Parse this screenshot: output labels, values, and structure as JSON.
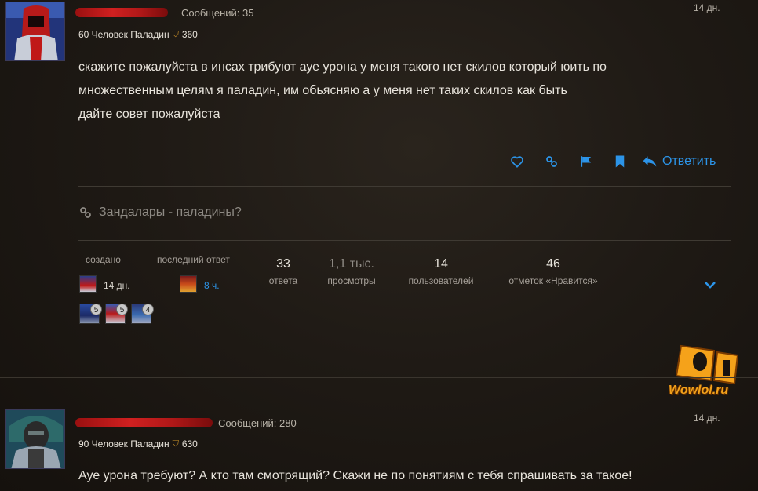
{
  "post1": {
    "posts_count": "Сообщений: 35",
    "level_class": "60 Человек Паладин",
    "achievement_points": "360",
    "date": "14 дн.",
    "body_lines": [
      "скажите пожалуйста в инсах трибуют ауе урона у меня такого нет скилов который юить по",
      "множественным целям я паладин, им обьясняю а у меня нет таких скилов как быть",
      "дайте совет пожалуйста"
    ],
    "reply_label": "Ответить"
  },
  "topic": {
    "link_text": "Зандалары - паладины?",
    "created_label": "создано",
    "created_time": "14 дн.",
    "last_reply_label": "последний ответ",
    "last_reply_time": "8 ч.",
    "stats": [
      {
        "num": "33",
        "label": "ответа"
      },
      {
        "num": "1,1 тыс.",
        "label": "просмотры"
      },
      {
        "num": "14",
        "label": "пользователей"
      },
      {
        "num": "46",
        "label": "отметок «Нравится»"
      }
    ],
    "participants": [
      {
        "count": "5"
      },
      {
        "count": "5"
      },
      {
        "count": "4"
      }
    ]
  },
  "watermark": {
    "site": "Wowlol.ru"
  },
  "post2": {
    "posts_count": "Сообщений: 280",
    "level_class": "90 Человек Паладин",
    "achievement_points": "630",
    "date": "14 дн.",
    "body": "Ауе урона требуют? А кто там смотрящий? Скажи не по понятиям с тебя спрашивать за такое!"
  },
  "colors": {
    "accent": "#2c94e8",
    "redaction": "#c81a1a",
    "achievement": "#d79a2a",
    "watermark": "#f2a21c"
  }
}
